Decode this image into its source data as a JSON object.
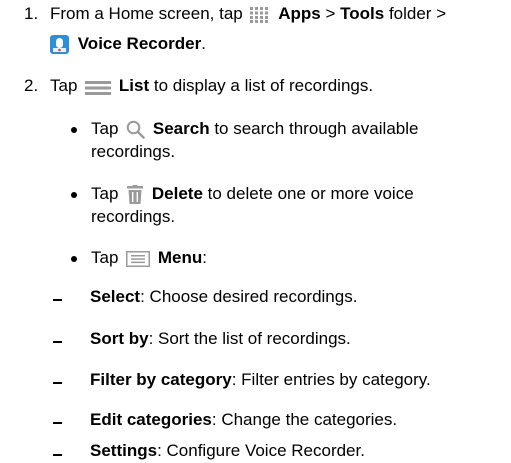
{
  "steps": [
    {
      "number": "1.",
      "line1": {
        "pre": "From a Home screen, tap",
        "apps": "Apps",
        "sep1": ">",
        "tools": "Tools",
        "mid": "folder",
        "sep2": ">"
      },
      "line2": {
        "voice": "Voice Recorder",
        "post": "."
      }
    },
    {
      "number": "2.",
      "pre": "Tap",
      "list": "List",
      "post": "to display a list of recordings."
    }
  ],
  "bullets": [
    {
      "pre": "Tap",
      "label": "Search",
      "post": "to search through available",
      "cont": "recordings."
    },
    {
      "pre": "Tap",
      "label": "Delete",
      "post": "to delete one or more voice",
      "cont": "recordings."
    },
    {
      "pre": "Tap",
      "label": "Menu",
      "post": ":"
    }
  ],
  "menu_items": [
    {
      "label": "Select",
      "desc": ": Choose desired recordings."
    },
    {
      "label": "Sort by",
      "desc": ": Sort the list of recordings."
    },
    {
      "label": "Filter by category",
      "desc": ": Filter entries by category."
    },
    {
      "label": "Edit categories",
      "desc": ": Change the categories."
    },
    {
      "label": "Settings",
      "desc": ": Configure Voice Recorder."
    }
  ],
  "icons": {
    "apps": "apps-grid-icon",
    "voice_recorder": "voice-recorder-app-icon",
    "list": "list-icon",
    "search": "search-icon",
    "delete": "trash-icon",
    "menu": "menu-icon"
  },
  "colors": {
    "icon_gray": "#9a9a9a",
    "recorder_blue": "#2e8fd6"
  }
}
